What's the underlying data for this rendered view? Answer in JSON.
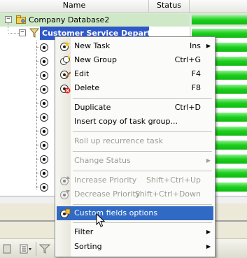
{
  "columns": {
    "name": "Name",
    "status": "Status"
  },
  "tree": {
    "root_label": "Company Database2",
    "selected_label": "Customer Service Department",
    "root_expander": "−",
    "child_expander": "−",
    "root_color": "#cfe8c7",
    "selected_color": "#2f59c8",
    "progress_color": "#1ccf1c",
    "task_rows": 11
  },
  "menu": {
    "items": [
      {
        "label": "New Task",
        "shortcut": "Ins",
        "submenu": true,
        "icon": "new-task-icon",
        "disabled": false
      },
      {
        "label": "New Group",
        "shortcut": "Ctrl+G",
        "submenu": false,
        "icon": "new-group-icon",
        "disabled": false
      },
      {
        "label": "Edit",
        "shortcut": "F4",
        "submenu": false,
        "icon": "edit-icon",
        "disabled": false
      },
      {
        "label": "Delete",
        "shortcut": "F8",
        "submenu": false,
        "icon": "delete-icon",
        "disabled": false
      },
      {
        "label": "Duplicate",
        "shortcut": "Ctrl+D",
        "submenu": false,
        "icon": "",
        "disabled": false
      },
      {
        "label": "Insert copy of task group...",
        "shortcut": "",
        "submenu": false,
        "icon": "",
        "disabled": false
      },
      {
        "label": "Roll up recurrence task",
        "shortcut": "",
        "submenu": false,
        "icon": "",
        "disabled": true
      },
      {
        "label": "Change Status",
        "shortcut": "",
        "submenu": true,
        "icon": "",
        "disabled": true
      },
      {
        "label": "Increase Priority",
        "shortcut": "Shift+Ctrl+Up",
        "submenu": false,
        "icon": "increase-priority-icon",
        "disabled": true
      },
      {
        "label": "Decrease Priority",
        "shortcut": "Shift+Ctrl+Down",
        "submenu": false,
        "icon": "decrease-priority-icon",
        "disabled": true
      },
      {
        "label": "Custom fields options",
        "shortcut": "",
        "submenu": false,
        "icon": "custom-fields-icon",
        "disabled": false,
        "highlighted": true
      },
      {
        "label": "Filter",
        "shortcut": "",
        "submenu": true,
        "icon": "",
        "disabled": false
      },
      {
        "label": "Sorting",
        "shortcut": "",
        "submenu": true,
        "icon": "",
        "disabled": false
      }
    ],
    "highlight_color": "#316ac5"
  }
}
